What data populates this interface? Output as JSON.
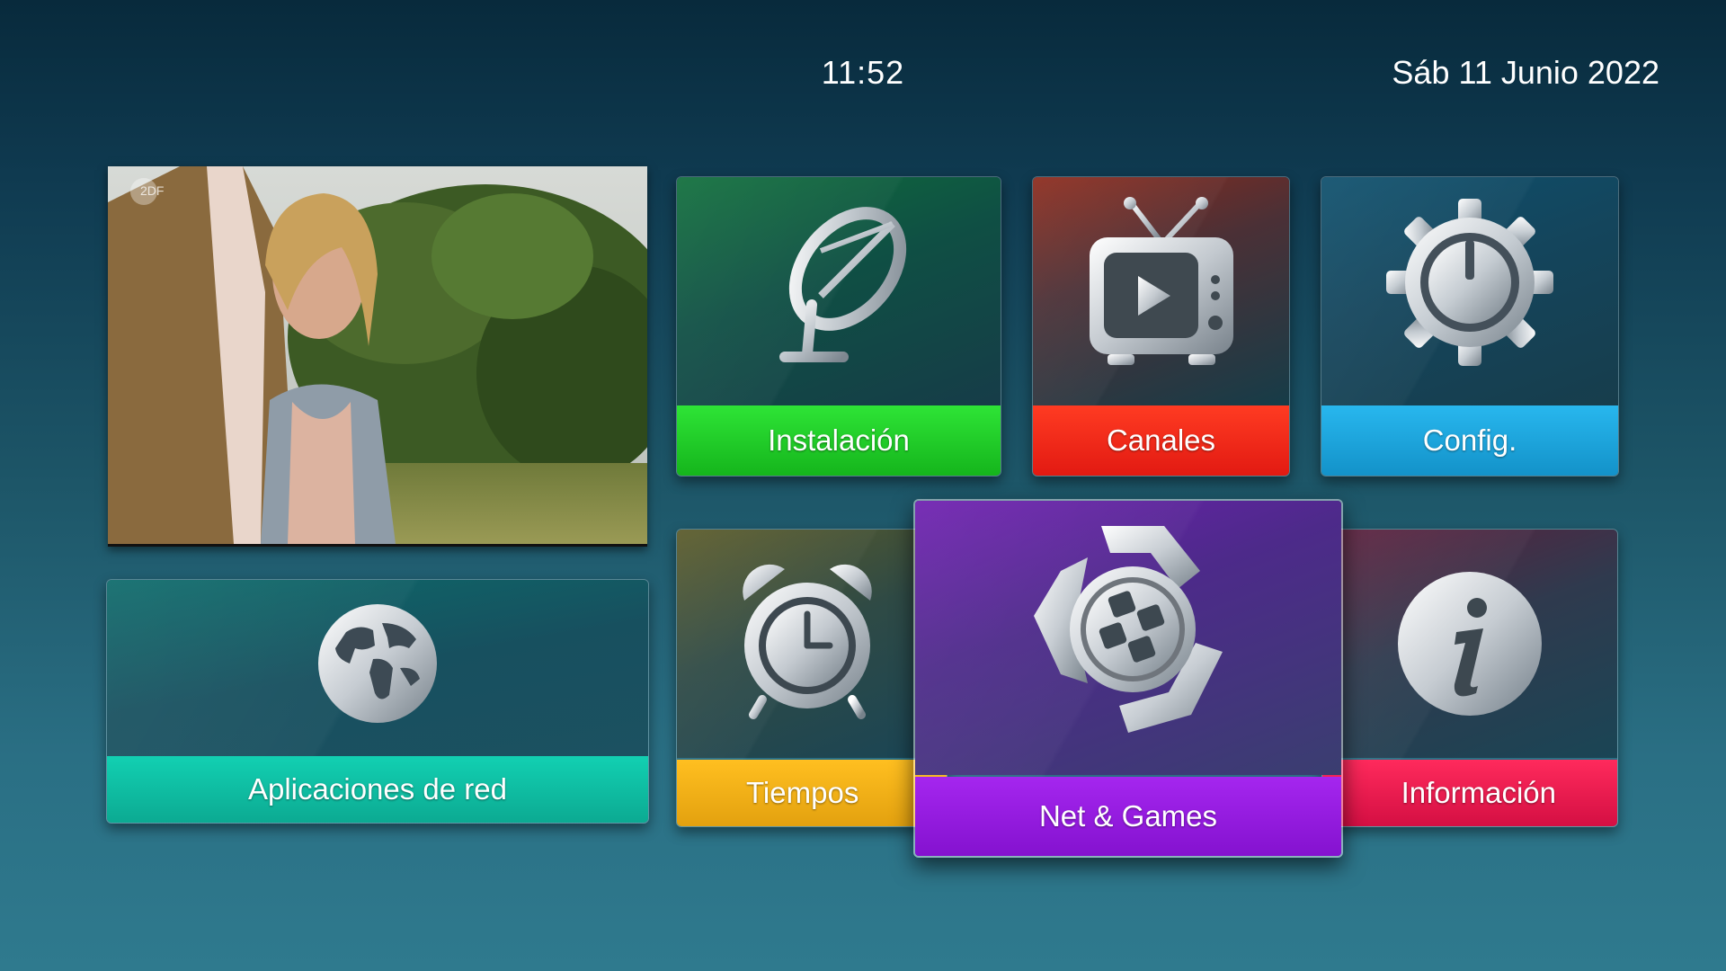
{
  "header": {
    "time": "11:52",
    "date": "Sáb 11 Junio 2022"
  },
  "preview": {
    "channel_logo": "2DF"
  },
  "menu": {
    "installation": {
      "label": "Instalación",
      "icon": "satellite-dish-icon",
      "color": "#19c31f"
    },
    "channels": {
      "label": "Canales",
      "icon": "tv-icon",
      "color": "#f0281a"
    },
    "settings": {
      "label": "Config.",
      "icon": "gear-icon",
      "color": "#1aa3d8"
    },
    "network_apps": {
      "label": "Aplicaciones de red",
      "icon": "globe-icon",
      "color": "#12b79f"
    },
    "timers": {
      "label": "Tiempos",
      "icon": "alarm-clock-icon",
      "color": "#f0b417"
    },
    "net_games": {
      "label": "Net & Games",
      "icon": "film-reel-icon",
      "color": "#8d12d6"
    },
    "information": {
      "label": "Información",
      "icon": "info-icon",
      "color": "#e8114d"
    }
  }
}
